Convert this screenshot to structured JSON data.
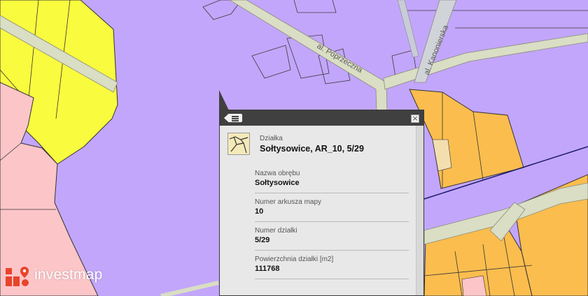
{
  "map": {
    "street_labels": [
      "al. Poprzeczna",
      "al. Kanonierska"
    ],
    "colors": {
      "background": "#c2a6fb",
      "yellow_zone": "#f9fb3f",
      "pink_zone": "#fcc5c8",
      "orange_zone": "#fbbd4e",
      "road": "#d9dec4",
      "parcel_line": "#3c3c3c"
    }
  },
  "popup": {
    "icon": "parcel-map-icon",
    "menu_icon": "list-menu-icon",
    "close_icon": "close-icon",
    "kind": "Działka",
    "title": "Sołtysowice, AR_10, 5/29",
    "attributes": [
      {
        "label": "Nazwa obrębu",
        "value": "Sołtysowice"
      },
      {
        "label": "Numer arkusza mapy",
        "value": "10"
      },
      {
        "label": "Numer działki",
        "value": "5/29"
      },
      {
        "label": "Powierzchnia działki [m2]",
        "value": "111768"
      }
    ]
  },
  "logo": {
    "text": "investmap",
    "mark_color": "#e8442a"
  }
}
